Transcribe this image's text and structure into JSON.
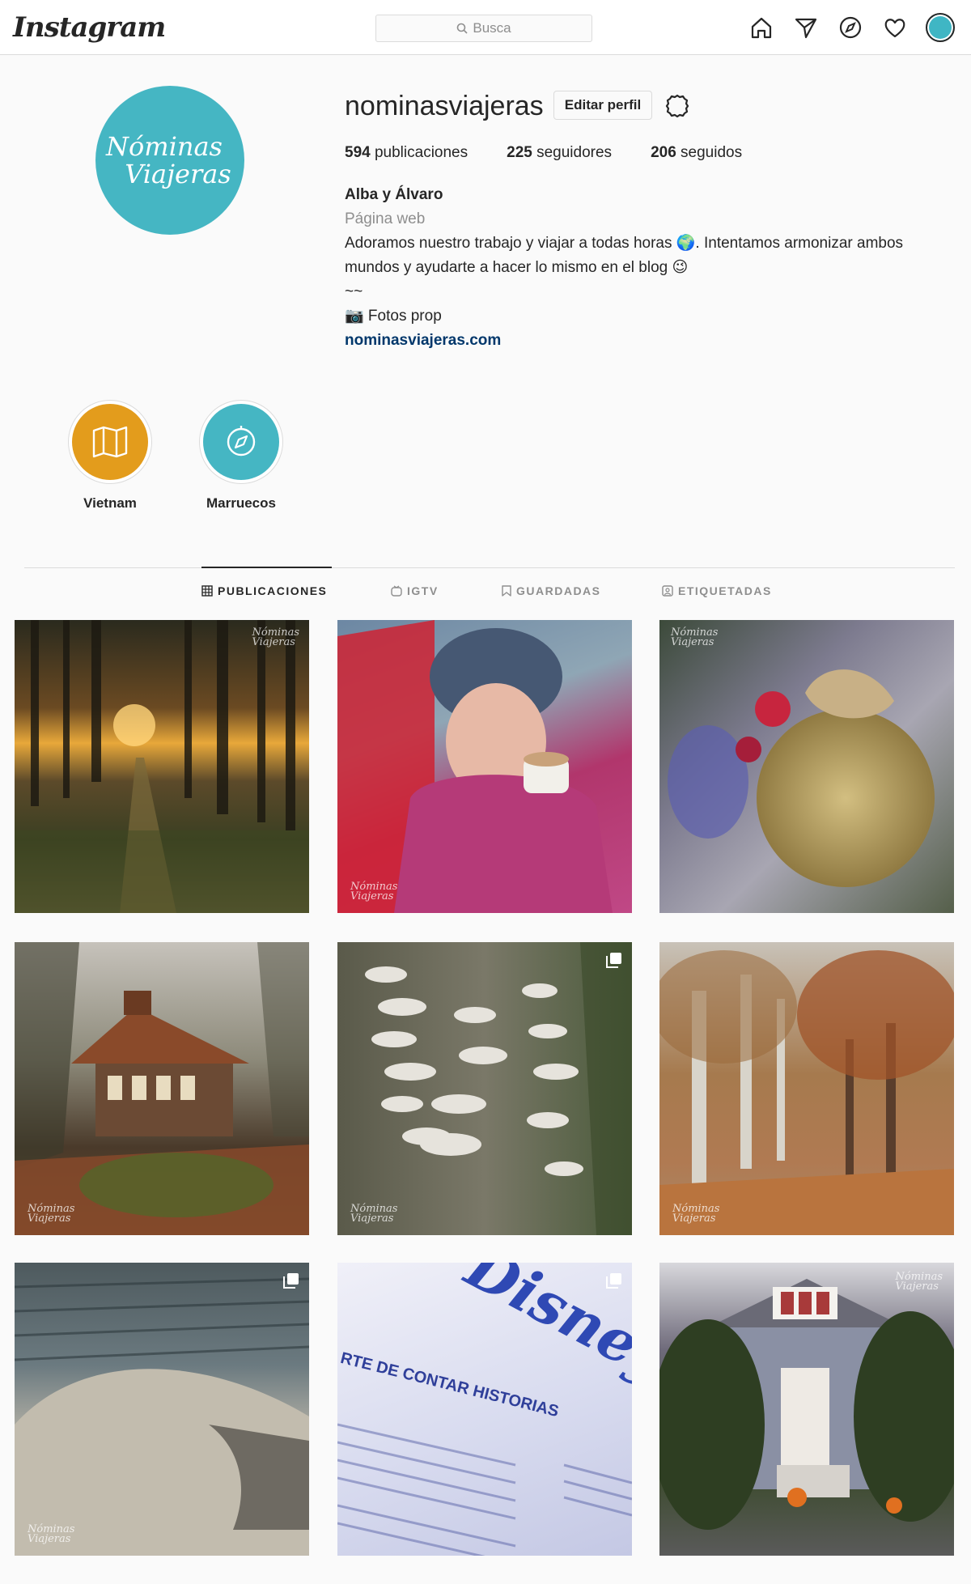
{
  "nav": {
    "logo": "Instagram",
    "search_placeholder": "Busca",
    "icons": [
      "home-icon",
      "direct-icon",
      "explore-icon",
      "activity-icon",
      "profile-avatar"
    ]
  },
  "profile": {
    "avatar_text_1": "Nóminas",
    "avatar_text_2": "Viajeras",
    "username": "nominasviajeras",
    "edit_label": "Editar perfil",
    "stats": [
      {
        "count": "594",
        "label": " publicaciones"
      },
      {
        "count": "225",
        "label": " seguidores"
      },
      {
        "count": "206",
        "label": " seguidos"
      }
    ],
    "full_name": "Alba y Álvaro",
    "category": "Página web",
    "bio_line1": "Adoramos nuestro trabajo y viajar a todas horas 🌍. Intentamos armonizar ambos mundos y ayudarte a hacer lo mismo en el blog 😉",
    "bio_line2": "~~",
    "bio_line3": "📷 Fotos prop",
    "website": "nominasviajeras.com"
  },
  "highlights": [
    {
      "label": "Vietnam",
      "color": "#e39c1c",
      "icon": "map-icon"
    },
    {
      "label": "Marruecos",
      "color": "#45b6c3",
      "icon": "compass-icon"
    }
  ],
  "tabs": [
    {
      "label": "PUBLICACIONES",
      "icon": "grid-icon",
      "active": true
    },
    {
      "label": "IGTV",
      "icon": "igtv-icon",
      "active": false
    },
    {
      "label": "GUARDADAS",
      "icon": "bookmark-icon",
      "active": false
    },
    {
      "label": "ETIQUETADAS",
      "icon": "tagged-icon",
      "active": false
    }
  ],
  "posts": [
    {
      "subject": "forest-sunset",
      "multi": false
    },
    {
      "subject": "woman-coffee",
      "multi": false
    },
    {
      "subject": "christmas-ornament",
      "multi": false
    },
    {
      "subject": "garden-pavilion",
      "multi": false
    },
    {
      "subject": "tree-fungi",
      "multi": true
    },
    {
      "subject": "autumn-avenue",
      "multi": false
    },
    {
      "subject": "stone-sculpture",
      "multi": true
    },
    {
      "subject": "disney-exhibit",
      "multi": true
    },
    {
      "subject": "halloween-house",
      "multi": false
    }
  ],
  "post_text": {
    "watermark_1": "Nóminas",
    "watermark_2": "Viajeras",
    "disney_title": "RTE DE CONTAR HISTORIAS",
    "disney_logo": "Disney"
  }
}
